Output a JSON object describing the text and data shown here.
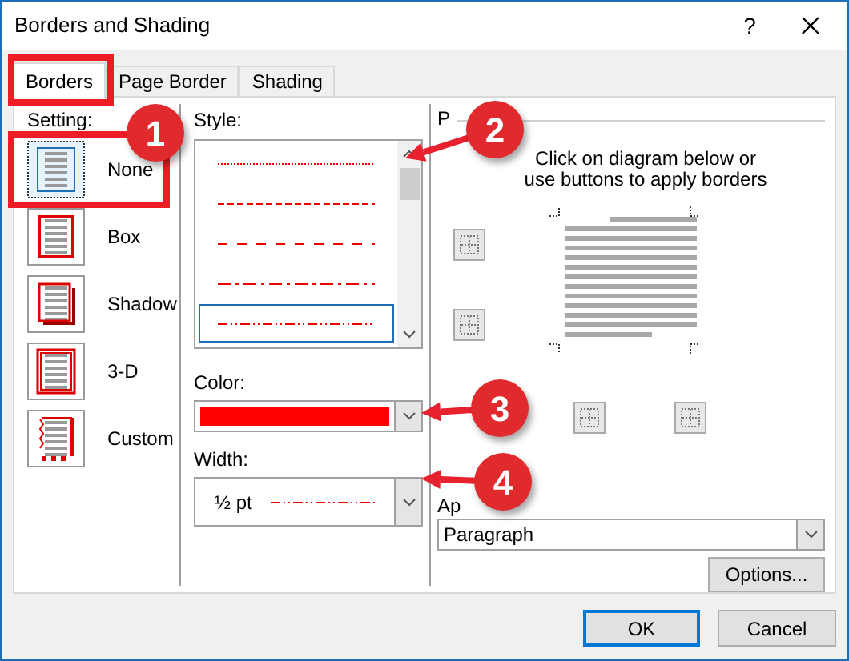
{
  "window": {
    "title": "Borders and Shading",
    "help": "?"
  },
  "tabs": [
    {
      "label": "Borders",
      "selected": true
    },
    {
      "label": "Page Border",
      "selected": false
    },
    {
      "label": "Shading",
      "selected": false
    }
  ],
  "setting": {
    "label": "Setting:",
    "items": [
      {
        "label": "None",
        "kind": "none",
        "selected": true
      },
      {
        "label": "Box",
        "kind": "box",
        "selected": false
      },
      {
        "label": "Shadow",
        "kind": "shadow",
        "selected": false
      },
      {
        "label": "3-D",
        "kind": "three-d",
        "selected": false
      },
      {
        "label": "Custom",
        "kind": "custom",
        "selected": false
      }
    ]
  },
  "style": {
    "label": "Style:",
    "items": [
      {
        "kind": "dotted",
        "selected": false
      },
      {
        "kind": "dashed-fine",
        "selected": false
      },
      {
        "kind": "dashed",
        "selected": false
      },
      {
        "kind": "dash-dot",
        "selected": false
      },
      {
        "kind": "dash-dot-dot",
        "selected": true
      }
    ]
  },
  "color": {
    "label": "Color:",
    "color": "#ff0000"
  },
  "width": {
    "label": "Width:",
    "value": "½ pt"
  },
  "preview": {
    "label": "P",
    "description": "Click on diagram below or use buttons to apply borders"
  },
  "apply_to": {
    "label": "Ap",
    "value": "Paragraph"
  },
  "buttons": {
    "options": "Options...",
    "ok": "OK",
    "cancel": "Cancel"
  },
  "annotations": [
    {
      "number": "1"
    },
    {
      "number": "2"
    },
    {
      "number": "3"
    },
    {
      "number": "4"
    }
  ]
}
